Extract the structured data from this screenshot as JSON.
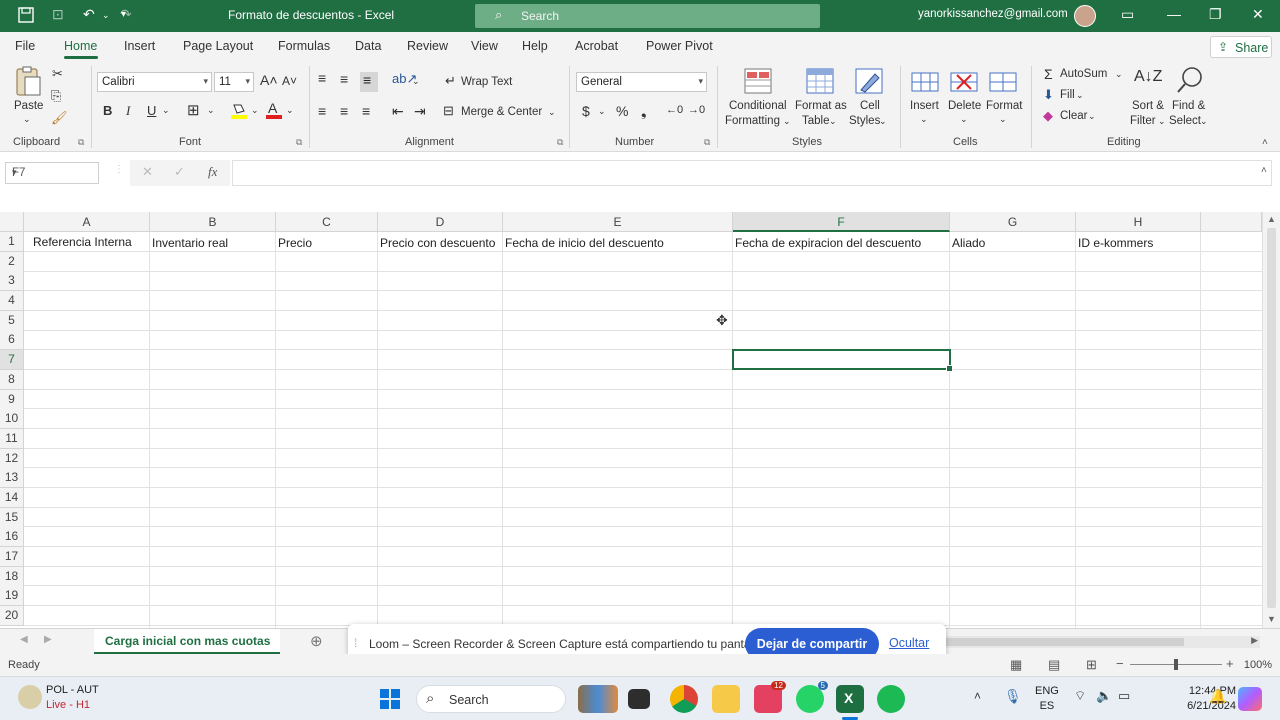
{
  "titlebar": {
    "doc_title": "Formato de descuentos  -  Excel",
    "search_placeholder": "Search",
    "user_email": "yanorkissanchez@gmail.com"
  },
  "ribbon_tabs": [
    "File",
    "Home",
    "Insert",
    "Page Layout",
    "Formulas",
    "Data",
    "Review",
    "View",
    "Help",
    "Acrobat",
    "Power Pivot"
  ],
  "share_label": "Share",
  "ribbon": {
    "clipboard": {
      "paste": "Paste",
      "label": "Clipboard"
    },
    "font": {
      "name": "Calibri",
      "size": "11",
      "label": "Font",
      "bold": "B",
      "italic": "I",
      "underline": "U"
    },
    "alignment": {
      "wrap": "Wrap Text",
      "merge": "Merge & Center",
      "label": "Alignment"
    },
    "number": {
      "format": "General",
      "label": "Number"
    },
    "styles": {
      "cond1": "Conditional",
      "cond2": "Formatting",
      "fmt1": "Format as",
      "fmt2": "Table",
      "cell1": "Cell",
      "cell2": "Styles",
      "label": "Styles"
    },
    "cells": {
      "insert": "Insert",
      "delete": "Delete",
      "format": "Format",
      "label": "Cells"
    },
    "editing": {
      "autosum": "AutoSum",
      "fill": "Fill",
      "clear": "Clear",
      "sort1": "Sort &",
      "sort2": "Filter",
      "find1": "Find &",
      "find2": "Select",
      "label": "Editing"
    }
  },
  "formula_bar": {
    "name_box": "F7",
    "fx": "fx",
    "value": ""
  },
  "grid": {
    "columns": [
      "A",
      "B",
      "C",
      "D",
      "E",
      "F",
      "G",
      "H"
    ],
    "rows": [
      "1",
      "2",
      "3",
      "4",
      "5",
      "6",
      "7",
      "8",
      "9",
      "10",
      "11",
      "12",
      "13",
      "14",
      "15",
      "16",
      "17",
      "18",
      "19",
      "20"
    ],
    "row1": [
      "Referencia Interna",
      "Inventario real",
      "Precio",
      "Precio con descuento",
      "Fecha de inicio del descuento",
      "Fecha de expiracion del descuento",
      "Aliado",
      "ID e-kommers"
    ],
    "selected_cell": "F7"
  },
  "sheet_tab": "Carga inicial con mas cuotas",
  "loom": {
    "message": "Loom – Screen Recorder & Screen Capture está compartiendo tu pantalla.",
    "stop": "Dejar de compartir",
    "hide": "Ocultar"
  },
  "status": {
    "ready": "Ready",
    "zoom": "100%"
  },
  "taskbar": {
    "weather1": "POL - AUT",
    "weather2": "Live - H1",
    "search": "Search",
    "lang1": "ENG",
    "lang2": "ES",
    "time": "12:44 PM",
    "date": "6/21/2024",
    "badge_teams": "12",
    "badge_whatsapp": "5"
  },
  "colors": {
    "excel_green": "#1f6f43",
    "loom_blue": "#2c5ed3"
  }
}
